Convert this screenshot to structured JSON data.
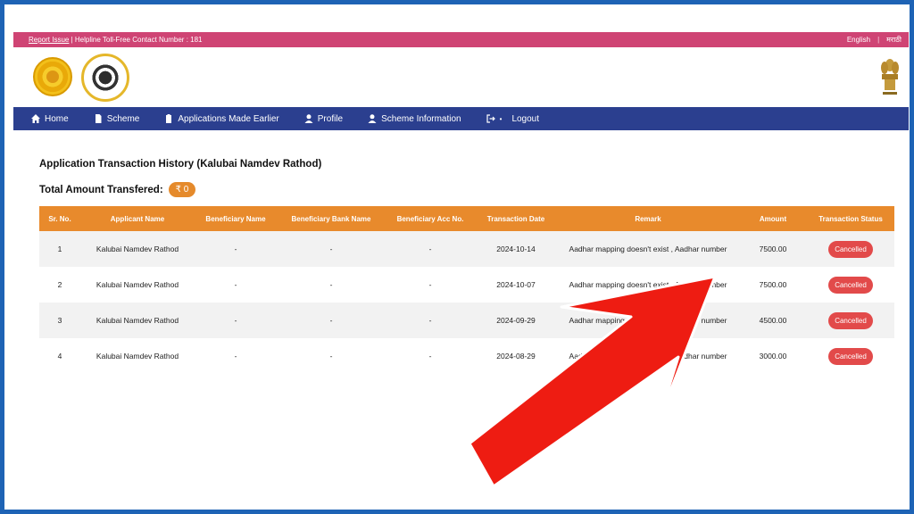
{
  "topbar": {
    "report_issue": "Report Issue",
    "helpline": "| Helpline Toll-Free Contact Number : 181",
    "lang_english": "English",
    "lang_separator": "|",
    "lang_marathi": "मराठी"
  },
  "nav": {
    "items": [
      {
        "label": "Home",
        "icon": "home-icon"
      },
      {
        "label": "Scheme",
        "icon": "document-icon"
      },
      {
        "label": "Applications Made Earlier",
        "icon": "clipboard-icon"
      },
      {
        "label": "Profile",
        "icon": "user-icon"
      },
      {
        "label": "Scheme Information",
        "icon": "user-icon"
      },
      {
        "label": "Logout",
        "icon": "logout-icon"
      }
    ]
  },
  "page": {
    "title": "Application Transaction History (Kalubai Namdev Rathod)",
    "total_label": "Total Amount Transfered:",
    "total_amount": "₹ 0"
  },
  "table": {
    "headers": [
      "Sr. No.",
      "Applicant Name",
      "Beneficiary Name",
      "Beneficiary Bank Name",
      "Beneficiary Acc No.",
      "Transaction Date",
      "Remark",
      "Amount",
      "Transaction Status"
    ],
    "rows": [
      {
        "sr": "1",
        "applicant": "Kalubai Namdev Rathod",
        "beneficiary": "-",
        "bank": "-",
        "acc": "-",
        "date": "2024-10-14",
        "remark": "Aadhar mapping doesn't exist , Aadhar number",
        "amount": "7500.00",
        "status": "Cancelled"
      },
      {
        "sr": "2",
        "applicant": "Kalubai Namdev Rathod",
        "beneficiary": "-",
        "bank": "-",
        "acc": "-",
        "date": "2024-10-07",
        "remark": "Aadhar mapping doesn't exist , Aadhar number",
        "amount": "7500.00",
        "status": "Cancelled"
      },
      {
        "sr": "3",
        "applicant": "Kalubai Namdev Rathod",
        "beneficiary": "-",
        "bank": "-",
        "acc": "-",
        "date": "2024-09-29",
        "remark": "Aadhar mapping doesn't exist , Aadhar number",
        "amount": "4500.00",
        "status": "Cancelled"
      },
      {
        "sr": "4",
        "applicant": "Kalubai Namdev Rathod",
        "beneficiary": "-",
        "bank": "-",
        "acc": "-",
        "date": "2024-08-29",
        "remark": "Aadhar mapping doesn't exist , Aadhar number",
        "amount": "3000.00",
        "status": "Cancelled"
      }
    ]
  },
  "colors": {
    "frame": "#1e63b5",
    "topbar": "#cf4474",
    "nav": "#2b3f8f",
    "table_header": "#e88a2c",
    "status_cancelled": "#e24a4a",
    "annotation_arrow": "#ee1c12"
  }
}
